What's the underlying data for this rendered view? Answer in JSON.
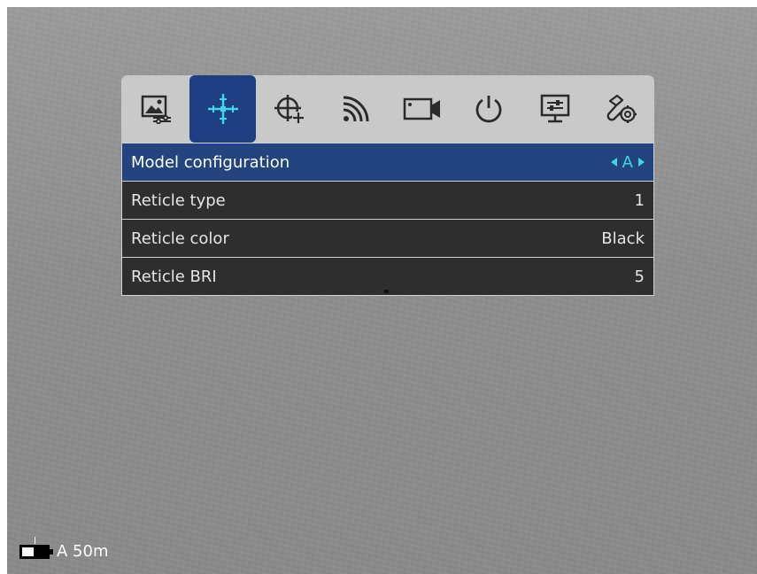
{
  "tabs": [
    {
      "id": "image-settings",
      "icon": "image-settings-icon",
      "active": false
    },
    {
      "id": "reticle-settings",
      "icon": "crosshair-icon",
      "active": true
    },
    {
      "id": "zeroing",
      "icon": "scope-adjust-icon",
      "active": false
    },
    {
      "id": "wireless",
      "icon": "wifi-signal-icon",
      "active": false
    },
    {
      "id": "recording",
      "icon": "video-camera-icon",
      "active": false
    },
    {
      "id": "power",
      "icon": "power-icon",
      "active": false
    },
    {
      "id": "display",
      "icon": "display-settings-icon",
      "active": false
    },
    {
      "id": "system",
      "icon": "system-settings-icon",
      "active": false
    }
  ],
  "rows": [
    {
      "label": "Model configuration",
      "value": "A",
      "selected": true
    },
    {
      "label": "Reticle type",
      "value": "1",
      "selected": false
    },
    {
      "label": "Reticle color",
      "value": "Black",
      "selected": false
    },
    {
      "label": "Reticle BRI",
      "value": "5",
      "selected": false
    }
  ],
  "status": {
    "battery_level": 0.45,
    "zero_profile": "A 50m"
  },
  "colors": {
    "active_tab": "#1f3f83",
    "selected_row": "#23447f",
    "accent": "#3fd7e6",
    "row_bg": "#2e2e2e",
    "tabbar_bg": "#c9c9c9"
  }
}
